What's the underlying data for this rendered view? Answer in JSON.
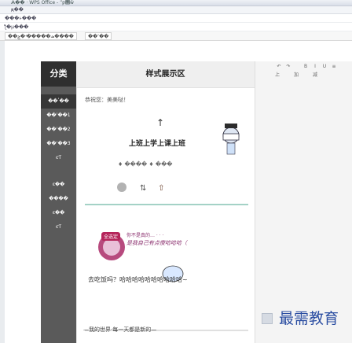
{
  "title_bar": {
    "text": "Ѧ�� · WPS Office - ˮƿ΢ŵ"
  },
  "menu": {
    "left_text": "ԭ��"
  },
  "info_rows": [
    {
      "label": "���ͱ���",
      "value": ""
    },
    {
      "label": "ƪ�µ���",
      "value": ""
    }
  ],
  "tabs": [
    "��ݼ�ʵ�����ܣ����",
    "��ʾ��"
  ],
  "sidebar": {
    "header": "分类",
    "items": [
      "��ʽ��",
      "��ʾ��1",
      "��ʾ��2",
      "��ʾ��3",
      "ͼƬ",
      "ͼ��",
      "����",
      "ͼ��",
      "ͼƬ"
    ]
  },
  "phone": {
    "header": "样式展示区",
    "greeting": "恭祝您：美美哒！",
    "pic_title": "上班上学上课上班",
    "pic_sub": "♦ ���� ♦ ���",
    "banner": {
      "badge": "全选定",
      "line1": "你不是真的…  ·  ·  ·",
      "line2": "是我自己有点傻哈哈哈（"
    },
    "quote": "去吃饭吗？哈哈哈哈哈哈哈哈哈哈~",
    "footer": "—我的世界·每一天都是新的—"
  },
  "toolbar": {
    "row1": [
      "↶",
      "↷",
      "B",
      "I",
      "U",
      "≡"
    ],
    "row2": [
      "上",
      "加",
      "减"
    ]
  },
  "watermark": "最需教育"
}
